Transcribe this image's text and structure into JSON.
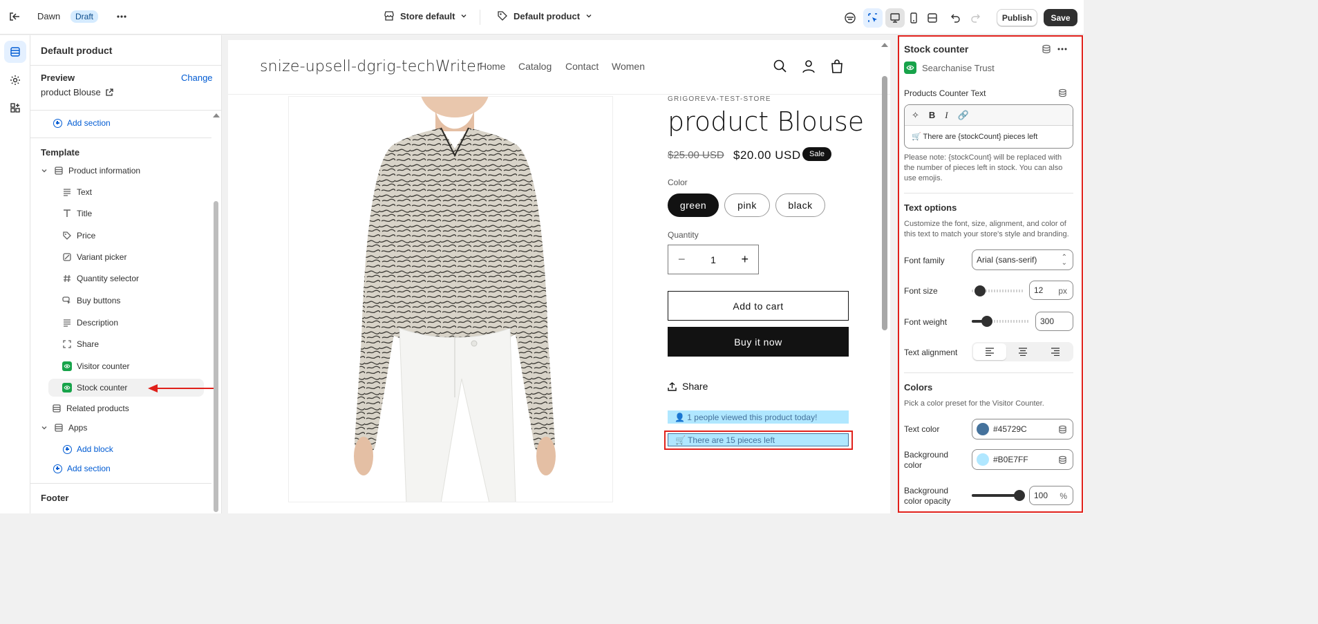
{
  "topbar": {
    "theme_name": "Dawn",
    "draft_badge": "Draft",
    "store_select": "Store default",
    "template_select": "Default product",
    "publish_label": "Publish",
    "save_label": "Save"
  },
  "left_panel": {
    "title": "Default product",
    "preview_label": "Preview",
    "change_link": "Change",
    "preview_product": "product Blouse",
    "add_section_top": "Add section",
    "template_heading": "Template",
    "product_information": "Product information",
    "blocks": [
      {
        "label": "Text",
        "icon": "text-icon"
      },
      {
        "label": "Title",
        "icon": "title-icon"
      },
      {
        "label": "Price",
        "icon": "price-tag-icon"
      },
      {
        "label": "Variant picker",
        "icon": "variant-icon"
      },
      {
        "label": "Quantity selector",
        "icon": "hash-icon"
      },
      {
        "label": "Buy buttons",
        "icon": "cursor-icon"
      },
      {
        "label": "Description",
        "icon": "text-icon"
      },
      {
        "label": "Share",
        "icon": "share-icon"
      },
      {
        "label": "Visitor counter",
        "icon": "app-icon"
      },
      {
        "label": "Stock counter",
        "icon": "app-icon"
      }
    ],
    "related_products": "Related products",
    "apps": "Apps",
    "add_block": "Add block",
    "add_section_bottom": "Add section",
    "footer_heading": "Footer"
  },
  "preview": {
    "store_name": "snize-upsell-dgrig-techWriter",
    "nav": [
      "Home",
      "Catalog",
      "Contact",
      "Women"
    ],
    "vendor": "GRIGOREVA-TEST-STORE",
    "product_title": "product Blouse",
    "price_old": "$25.00 USD",
    "price_new": "$20.00 USD",
    "sale_badge": "Sale",
    "color_label": "Color",
    "colors": [
      "green",
      "pink",
      "black"
    ],
    "quantity_label": "Quantity",
    "quantity_value": "1",
    "add_to_cart": "Add to cart",
    "buy_now": "Buy it now",
    "share": "Share",
    "visitor_text": "👤 1 people viewed this product today!",
    "stock_text": "🛒 There are 15 pieces left"
  },
  "right_panel": {
    "title": "Stock counter",
    "app_name": "Searchanise Trust",
    "counter_text_label": "Products Counter Text",
    "counter_text_value": "🛒 There are {stockCount} pieces left",
    "counter_help": "Please note: {stockCount} will be replaced with the number of pieces left in stock. You can also use emojis.",
    "text_options_heading": "Text options",
    "text_options_help": "Customize the font, size, alignment, and color of this text to match your store's style and branding.",
    "font_family_label": "Font family",
    "font_family_value": "Arial (sans-serif)",
    "font_size_label": "Font size",
    "font_size_value": "12",
    "font_size_unit": "px",
    "font_weight_label": "Font weight",
    "font_weight_value": "300",
    "text_alignment_label": "Text alignment",
    "colors_heading": "Colors",
    "colors_help": "Pick a color preset for the Visitor Counter.",
    "text_color_label": "Text color",
    "text_color_value": "#45729C",
    "bg_color_label": "Background color",
    "bg_color_value": "#B0E7FF",
    "bg_opacity_label": "Background color opacity",
    "bg_opacity_value": "100",
    "bg_opacity_unit": "%"
  },
  "colors": {
    "accent_blue": "#005bd3",
    "highlight_red": "#e0201a",
    "counter_text": "#45729C",
    "counter_bg": "#B0E7FF"
  }
}
